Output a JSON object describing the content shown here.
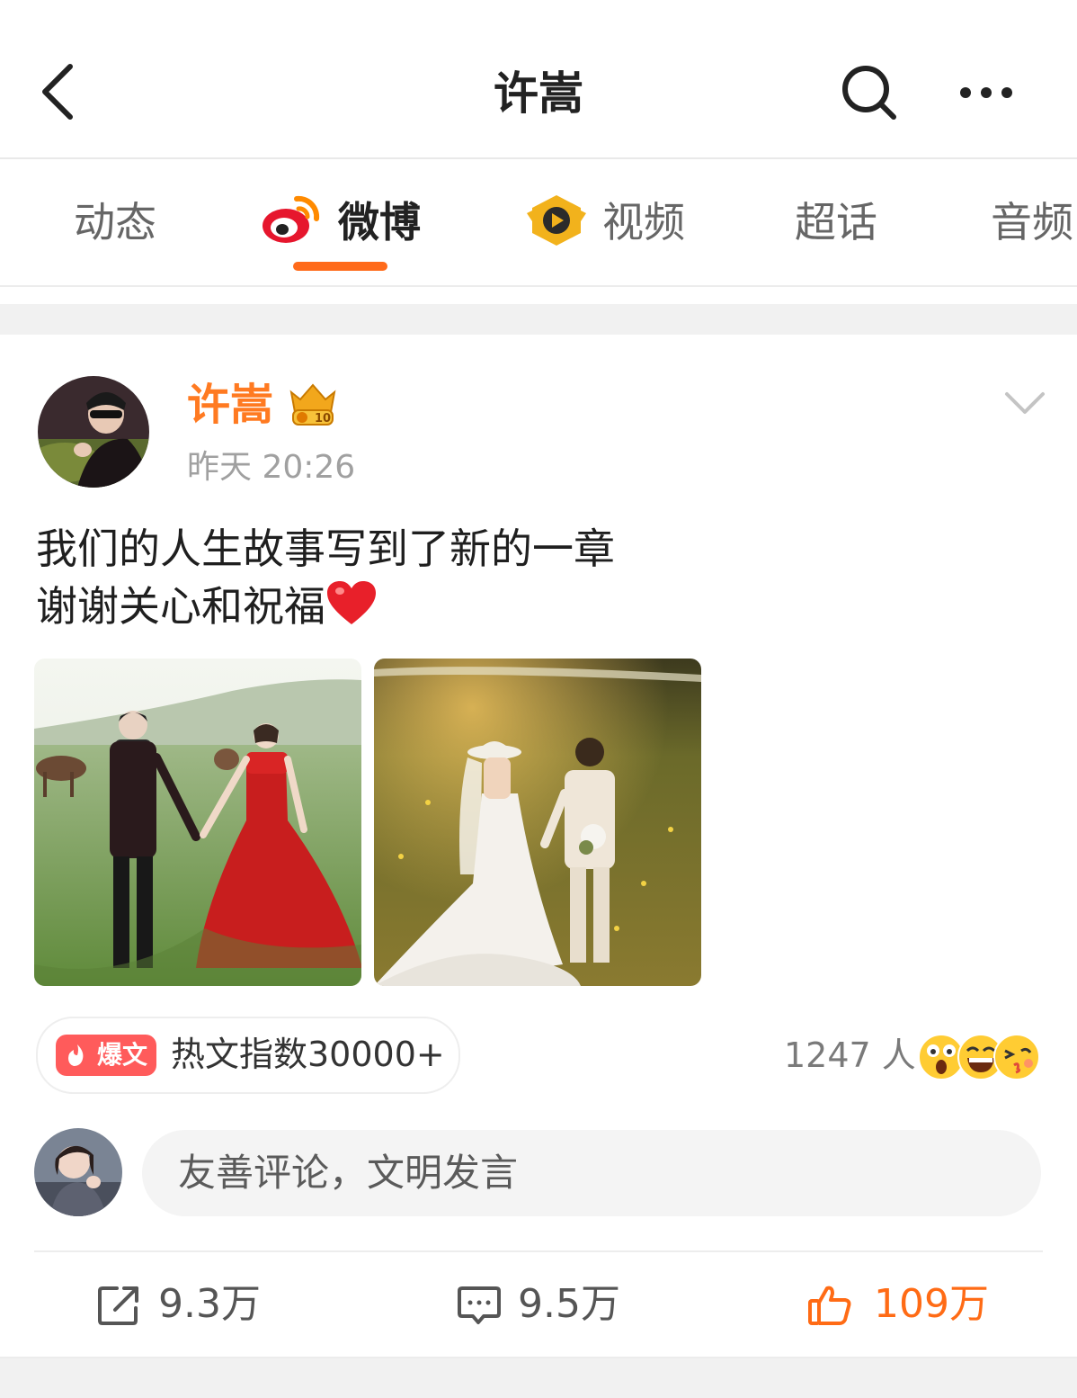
{
  "header": {
    "title": "许嵩",
    "back_icon": "back-arrow-icon",
    "search_icon": "search-icon",
    "more_icon": "more-icon"
  },
  "tabs": [
    {
      "label": "动态",
      "active": false
    },
    {
      "label": "微博",
      "active": true,
      "icon": "weibo-logo-icon"
    },
    {
      "label": "视频",
      "active": false,
      "icon": "video-logo-icon"
    },
    {
      "label": "超话",
      "active": false
    },
    {
      "label": "音频",
      "active": false
    }
  ],
  "post": {
    "author": "许嵩",
    "time": "昨天 20:26",
    "text_line1": "我们的人生故事写到了新的一章",
    "text_line2": "谢谢关心和祝福",
    "emoji": "heart-icon",
    "images": [
      "wedding-photo-red-dress",
      "wedding-photo-white-dress"
    ],
    "hot": {
      "tag": "爆文",
      "text": "热文指数30000+"
    },
    "reactions": {
      "count": "1247 人",
      "emojis": [
        "surprised-emoji-icon",
        "laughing-emoji-icon",
        "kiss-emoji-icon"
      ]
    }
  },
  "comment": {
    "placeholder": "友善评论，文明发言"
  },
  "actions": {
    "share": "9.3万",
    "comment": "9.5万",
    "like": "109万"
  },
  "colors": {
    "accent": "#ff6a1a",
    "author_name": "#ff7a21",
    "hot_tag": "#ff5b5b",
    "like_active": "#ff6b15"
  }
}
